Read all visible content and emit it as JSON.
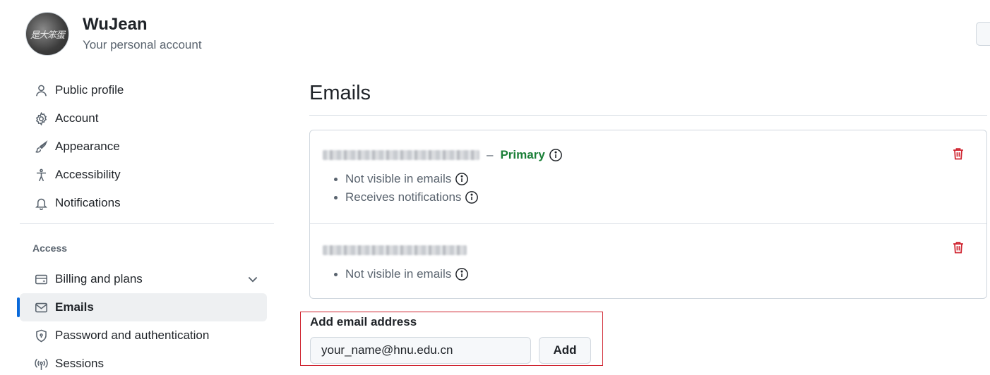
{
  "account": {
    "name": "WuJean",
    "subtitle": "Your personal account",
    "avatar_text": "是大笨蛋"
  },
  "sidebar": {
    "items": [
      {
        "label": "Public profile",
        "icon": "person-icon"
      },
      {
        "label": "Account",
        "icon": "gear-icon"
      },
      {
        "label": "Appearance",
        "icon": "paintbrush-icon"
      },
      {
        "label": "Accessibility",
        "icon": "accessibility-icon"
      },
      {
        "label": "Notifications",
        "icon": "bell-icon"
      }
    ],
    "access_label": "Access",
    "access_items": [
      {
        "label": "Billing and plans",
        "icon": "credit-card-icon",
        "expandable": true
      },
      {
        "label": "Emails",
        "icon": "mail-icon",
        "active": true
      },
      {
        "label": "Password and authentication",
        "icon": "shield-lock-icon"
      },
      {
        "label": "Sessions",
        "icon": "broadcast-icon"
      }
    ]
  },
  "main": {
    "title": "Emails",
    "emails": [
      {
        "primary_label": "Primary",
        "details": [
          "Not visible in emails",
          "Receives notifications"
        ]
      },
      {
        "details": [
          "Not visible in emails"
        ]
      }
    ],
    "add_email": {
      "label": "Add email address",
      "value": "your_name@hnu.edu.cn",
      "button": "Add"
    }
  },
  "colors": {
    "accent": "#0969da",
    "primary_green": "#1a7f37",
    "danger_red": "#cf222e"
  }
}
